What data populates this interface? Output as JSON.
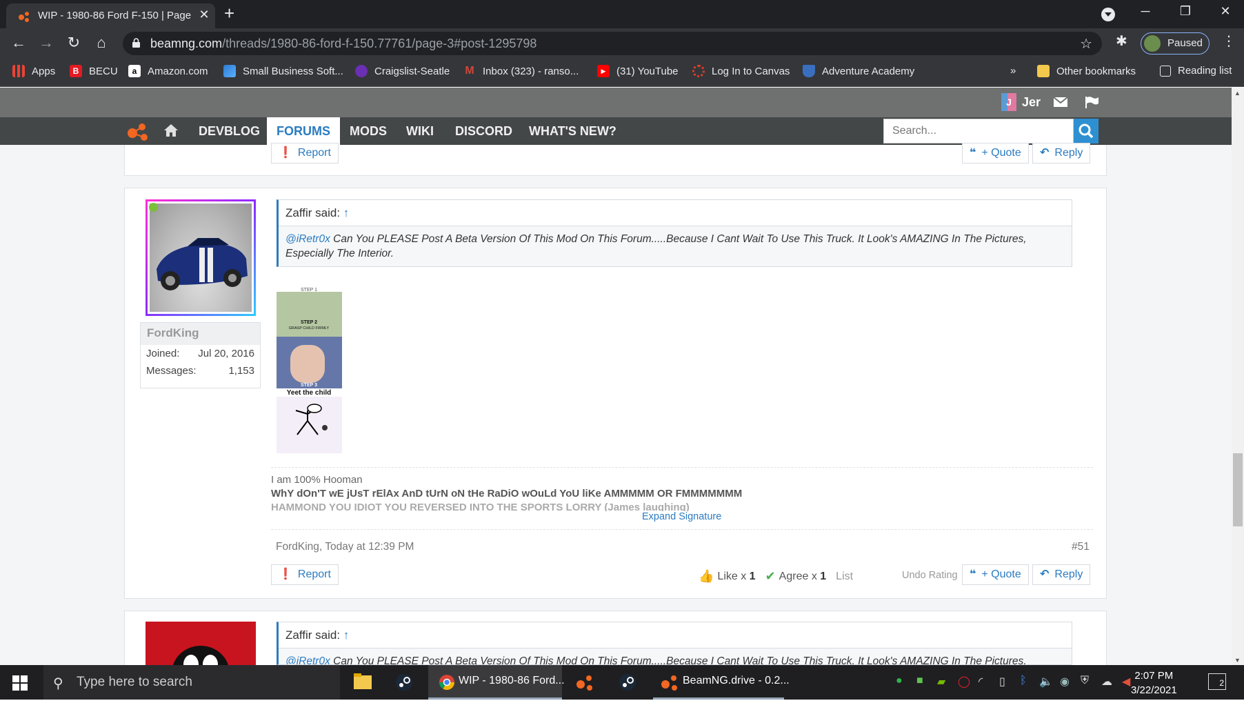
{
  "browser": {
    "tab_title": "WIP - 1980-86 Ford F-150 | Page",
    "tab_close": "✕",
    "new_tab": "+",
    "url_host": "beamng.com",
    "url_path": "/threads/1980-86-ford-f-150.77761/page-3#post-1295798",
    "profile_status": "Paused",
    "minimize": "─",
    "maximize": "❐",
    "close": "✕"
  },
  "bookmarks": [
    {
      "label": "Apps",
      "icon": "apps-grid-icon",
      "color": "#e8453c"
    },
    {
      "label": "BECU",
      "icon": "becu-icon",
      "color": "#e31b23",
      "glyph": "B"
    },
    {
      "label": "Amazon.com",
      "icon": "amazon-icon",
      "color": "#ffffff",
      "glyph": "a"
    },
    {
      "label": "Small Business Soft...",
      "icon": "software-icon",
      "color": "#2e7bcf"
    },
    {
      "label": "Craigslist-Seatle",
      "icon": "craigslist-icon",
      "color": "#6a2fb2"
    },
    {
      "label": "Inbox (323) - ranso...",
      "icon": "gmail-icon",
      "color": "#d44638",
      "glyph": "M"
    },
    {
      "label": "(31) YouTube",
      "icon": "youtube-icon",
      "color": "#ff0000",
      "glyph": "▶"
    },
    {
      "label": "Log In to Canvas",
      "icon": "canvas-icon",
      "color": "#e13f29"
    },
    {
      "label": "Adventure Academy",
      "icon": "adventure-academy-icon",
      "color": "#3a6fc0"
    }
  ],
  "bookmarks_overflow": "»",
  "other_bookmarks": "Other bookmarks",
  "reading_list": "Reading list",
  "site": {
    "username": "Jer",
    "user_initial": "J",
    "nav": [
      "DEVBLOG",
      "FORUMS",
      "MODS",
      "WIKI",
      "DISCORD",
      "WHAT'S NEW?"
    ],
    "active_nav": "FORUMS",
    "search_placeholder": "Search..."
  },
  "prev_post_actions": {
    "report": "Report",
    "quote": "+ Quote",
    "reply": "Reply"
  },
  "post": {
    "author": "FordKing",
    "joined_label": "Joined:",
    "joined_value": "Jul 20, 2016",
    "messages_label": "Messages:",
    "messages_value": "1,153",
    "quote_author": "Zaffir said:",
    "quote_arrow": "↑",
    "quote_mention": "@iRetr0x",
    "quote_text": " Can You PLEASE Post A Beta Version Of This Mod On This Forum.....Because I Cant Wait To Use This Truck. It Look's AMAZING In The Pictures, Especially The Interior.",
    "meme": {
      "step1": "STEP 1",
      "step2": "STEP 2",
      "step2_sub": "GRASP CHILD FIRMLY",
      "step3": "STEP 3",
      "caption": "Yeet the child"
    },
    "signature": {
      "line1": "I am 100% Hooman",
      "line2": "WhY dOn'T wE jUsT rElAx AnD tUrN oN tHe RaDiO wOuLd YoU liKe AMMMMM OR FMMMMMMM",
      "line3": "HAMMOND YOU IDIOT YOU REVERSED INTO THE SPORTS LORRY (James laughing)",
      "expand": "Expand Signature"
    },
    "meta": "FordKing, Today at 12:39 PM",
    "number": "#51",
    "report": "Report",
    "like": "Like x",
    "like_count": "1",
    "agree": "Agree x",
    "agree_count": "1",
    "list": "List",
    "undo_rating": "Undo Rating",
    "quote": "+ Quote",
    "reply": "Reply"
  },
  "next_post": {
    "quote_author": "Zaffir said:",
    "quote_arrow": "↑",
    "quote_mention": "@iRetr0x",
    "quote_text": " Can You PLEASE Post A Beta Version Of This Mod On This Forum.....Because I Cant Wait To Use This Truck. It Look's AMAZING In The Pictures, Especially"
  },
  "taskbar": {
    "search_placeholder": "Type here to search",
    "chrome_label": "WIP - 1980-86 Ford...",
    "beamng_label": "BeamNG.drive - 0.2...",
    "time": "2:07 PM",
    "date": "3/22/2021",
    "notifications": "2"
  }
}
